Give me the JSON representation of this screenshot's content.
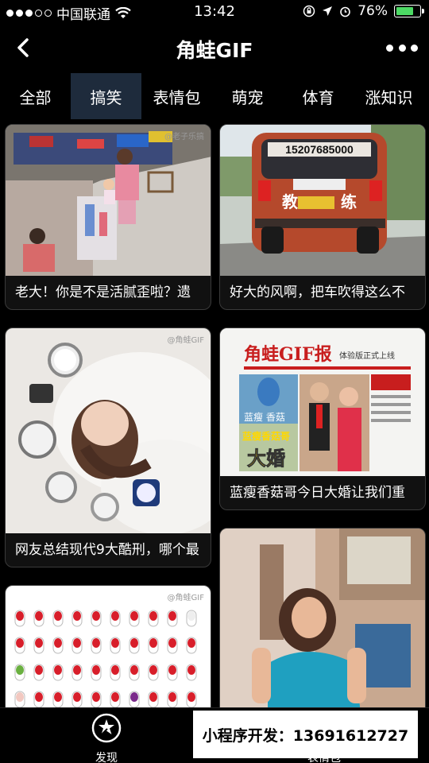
{
  "status_bar": {
    "carrier": "中国联通",
    "time": "13:42",
    "battery_percent": "76%",
    "battery_level": 0.76,
    "signal_icon": "signal-dots-icon",
    "wifi_icon": "wifi-icon"
  },
  "nav": {
    "title": "角蛙GIF",
    "back_icon": "back-chevron-icon",
    "more_icon": "more-dots-icon"
  },
  "tabs": [
    {
      "label": "全部",
      "active": false
    },
    {
      "label": "搞笑",
      "active": true
    },
    {
      "label": "表情包",
      "active": false
    },
    {
      "label": "萌宠",
      "active": false
    },
    {
      "label": "体育",
      "active": false
    },
    {
      "label": "涨知识",
      "active": false
    }
  ],
  "cards": [
    {
      "caption": "老大！你是不是活腻歪啦？遗",
      "watermark": "@老子乐搞"
    },
    {
      "caption": "好大的风啊，把车吹得这么不",
      "plate": "15207685000",
      "sign_left": "教",
      "sign_right": "练"
    },
    {
      "caption": "网友总结现代9大酷刑，哪个最",
      "watermark": "@角蛙GIF"
    },
    {
      "caption": "蓝瘦香菇哥今日大婚让我们重",
      "newspaper_title": "角蛙GIF报",
      "newspaper_sub": "体验版正式上线",
      "headline_top": "蓝瘦 香菇",
      "headline_mid": "蓝瘦香菇哥",
      "headline_big": "大婚"
    },
    {
      "caption": "",
      "watermark": "@角蛙GIF"
    },
    {
      "caption": ""
    }
  ],
  "bottom_bar": {
    "discover_label": "发现",
    "discover_icon": "magic-wand-icon",
    "emoji_label": "表情包",
    "emoji_icon": "emoji-icon"
  },
  "promo": {
    "text": "小程序开发：13691612727"
  },
  "colors": {
    "background": "#000000",
    "active_tab": "#1e2b3c",
    "battery": "#4cd964",
    "card_border": "#3a3a3a"
  }
}
